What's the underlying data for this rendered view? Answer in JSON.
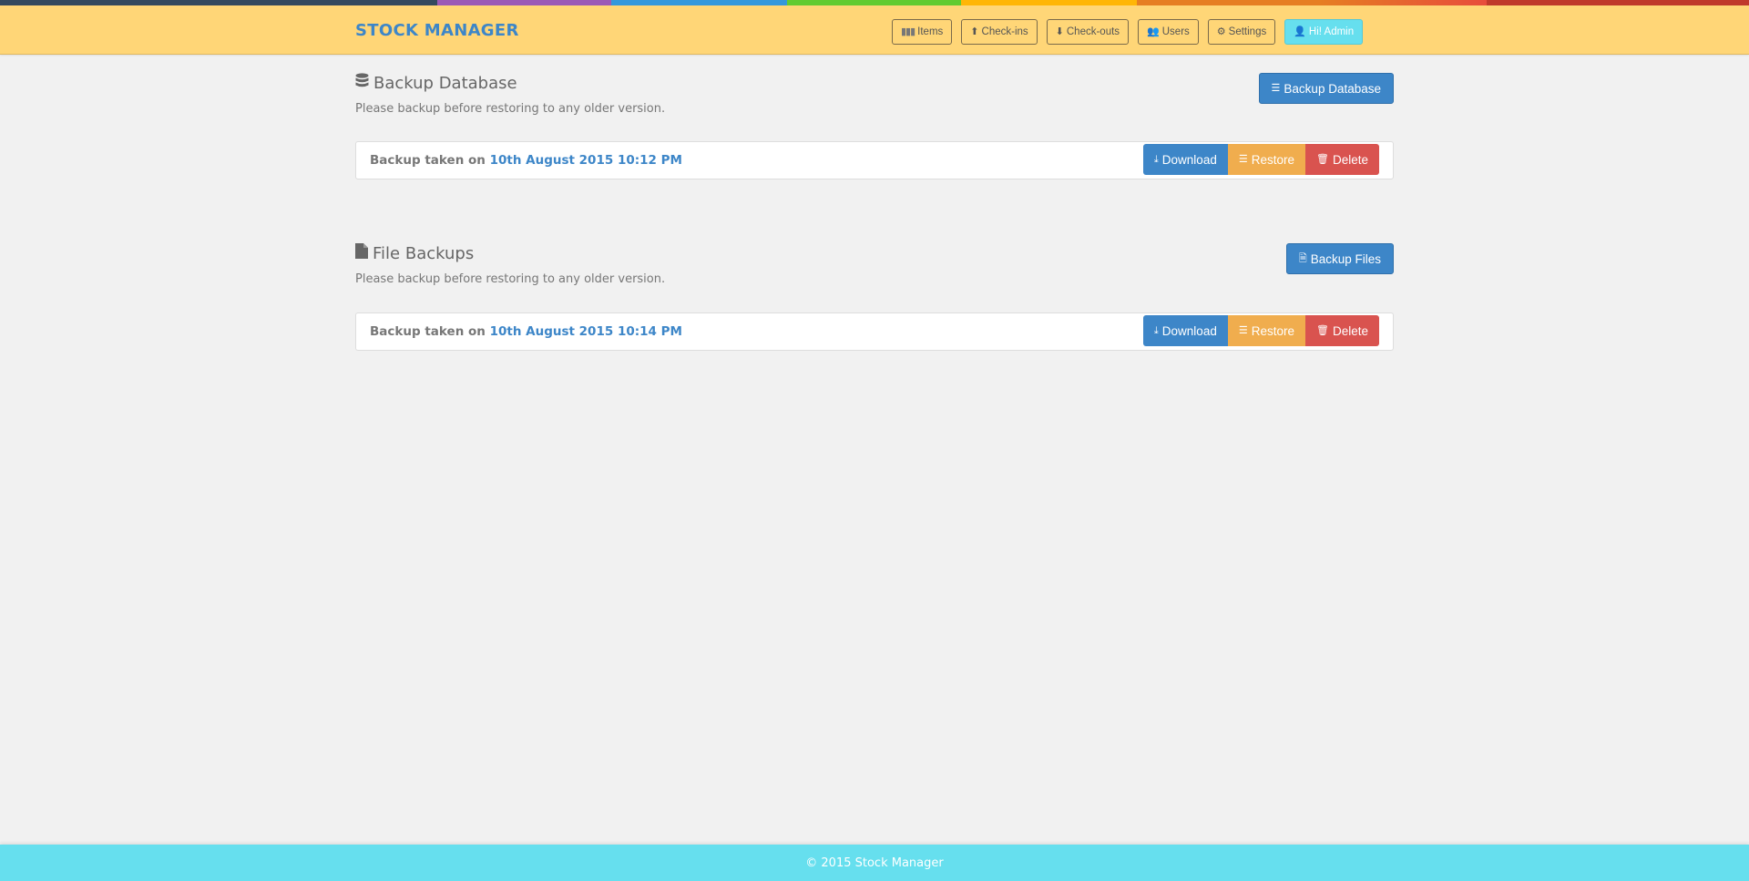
{
  "rainbow": [
    "#34495e",
    "#9b59b6",
    "#3498db",
    "#62cb31",
    "#ffb606",
    "#e67e22",
    "#e74c3c",
    "#c0392b"
  ],
  "header": {
    "brand": "STOCK MANAGER",
    "nav": [
      {
        "label": "Items",
        "icon": "barcode-icon"
      },
      {
        "label": "Check-ins",
        "icon": "arrow-circle-up-icon"
      },
      {
        "label": "Check-outs",
        "icon": "arrow-circle-down-icon"
      },
      {
        "label": "Users",
        "icon": "users-icon"
      },
      {
        "label": "Settings",
        "icon": "cogs-icon"
      },
      {
        "label": "Hi! Admin",
        "icon": "user-icon"
      }
    ]
  },
  "database": {
    "title": "Backup Database",
    "subtitle": "Please backup before restoring to any older version.",
    "action_label": "Backup Database",
    "backups": [
      {
        "prefix": "Backup taken on",
        "date": "10th August 2015 10:12 PM"
      }
    ]
  },
  "files": {
    "title": "File Backups",
    "subtitle": "Please backup before restoring to any older version.",
    "action_label": "Backup Files",
    "backups": [
      {
        "prefix": "Backup taken on",
        "date": "10th August 2015 10:14 PM"
      }
    ]
  },
  "row_actions": {
    "download": "Download",
    "restore": "Restore",
    "delete": "Delete"
  },
  "footer": {
    "text": "© 2015 Stock Manager"
  },
  "colors": {
    "header_bg": "#ffd677",
    "brand": "#3d86c8",
    "primary": "#3d86c8",
    "warning": "#f0ad4e",
    "danger": "#d9534f",
    "footer_bg": "#66dfee"
  }
}
